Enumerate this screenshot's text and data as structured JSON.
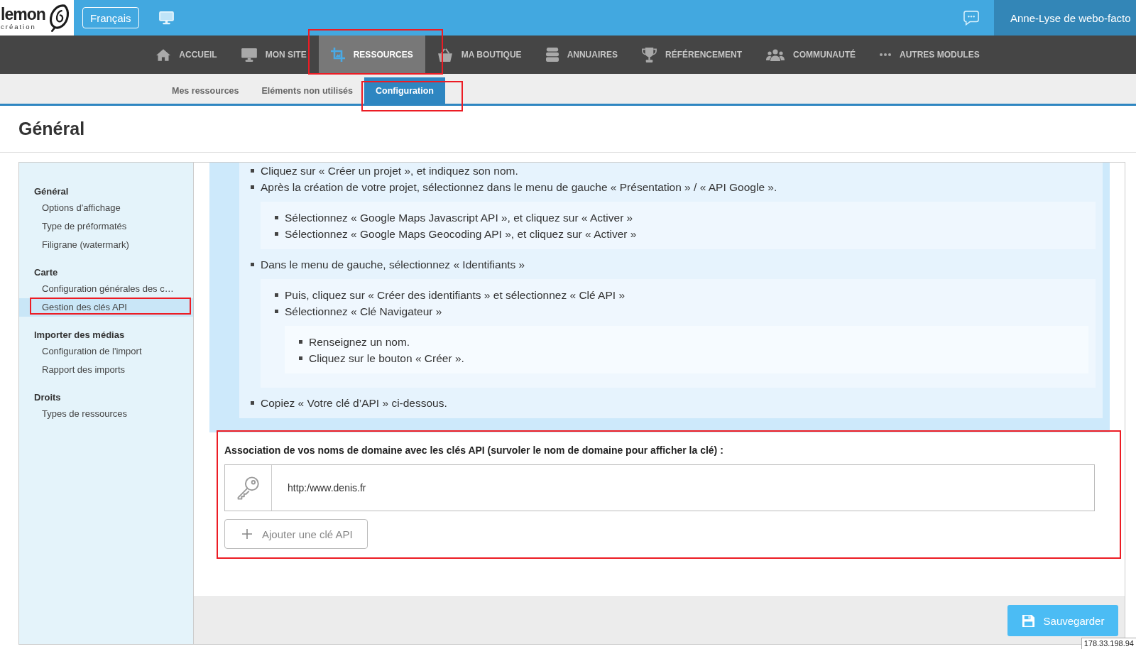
{
  "top_bar": {
    "logo": {
      "name": "lemon",
      "tagline": "création"
    },
    "language_button": "Français",
    "user_name": "Anne-Lyse de webo-facto"
  },
  "main_nav": [
    {
      "label": "ACCUEIL",
      "selected": false,
      "highlighted": false
    },
    {
      "label": "MON SITE",
      "selected": false,
      "highlighted": false
    },
    {
      "label": "RESSOURCES",
      "selected": true,
      "highlighted": true
    },
    {
      "label": "MA BOUTIQUE",
      "selected": false,
      "highlighted": false
    },
    {
      "label": "ANNUAIRES",
      "selected": false,
      "highlighted": false
    },
    {
      "label": "RÉFÉRENCEMENT",
      "selected": false,
      "highlighted": false
    },
    {
      "label": "COMMUNAUTÉ",
      "selected": false,
      "highlighted": false
    },
    {
      "label": "AUTRES MODULES",
      "selected": false,
      "highlighted": false
    }
  ],
  "sub_nav": [
    {
      "label": "Mes ressources",
      "selected": false,
      "highlighted": false
    },
    {
      "label": "Eléments non utilisés",
      "selected": false,
      "highlighted": false
    },
    {
      "label": "Configuration",
      "selected": true,
      "highlighted": true
    }
  ],
  "page_title": "Général",
  "sidebar": {
    "groups": [
      {
        "title": "Général",
        "items": [
          {
            "label": "Options d'affichage",
            "selected": false,
            "highlighted": false
          },
          {
            "label": "Type de préformatés",
            "selected": false,
            "highlighted": false
          },
          {
            "label": "Filigrane (watermark)",
            "selected": false,
            "highlighted": false
          }
        ]
      },
      {
        "title": "Carte",
        "items": [
          {
            "label": "Configuration générales des c…",
            "selected": false,
            "highlighted": false
          },
          {
            "label": "Gestion des clés API",
            "selected": true,
            "highlighted": true
          }
        ]
      },
      {
        "title": "Importer des médias",
        "items": [
          {
            "label": "Configuration de l'import",
            "selected": false,
            "highlighted": false
          },
          {
            "label": "Rapport des imports",
            "selected": false,
            "highlighted": false
          }
        ]
      },
      {
        "title": "Droits",
        "items": [
          {
            "label": "Types de ressources",
            "selected": false,
            "highlighted": false
          }
        ]
      }
    ]
  },
  "instructions": [
    {
      "text": "Cliquez sur « Créer un projet », et indiquez son nom."
    },
    {
      "text": "Après la création de votre projet, sélectionnez dans le menu de gauche « Présentation » / « API Google ».",
      "children": [
        {
          "text": "Sélectionnez « Google Maps Javascript API », et cliquez sur « Activer »"
        },
        {
          "text": "Sélectionnez « Google Maps Geocoding API », et cliquez sur « Activer »"
        }
      ]
    },
    {
      "text": "Dans le menu de gauche, sélectionnez « Identifiants »",
      "children": [
        {
          "text": "Puis, cliquez sur « Créer des identifiants » et sélectionnez « Clé API »"
        },
        {
          "text": "Sélectionnez « Clé Navigateur »",
          "children": [
            {
              "text": "Renseignez un nom."
            },
            {
              "text": "Cliquez sur le bouton « Créer »."
            }
          ]
        }
      ]
    },
    {
      "text": "Copiez « Votre clé d’API » ci-dessous."
    }
  ],
  "domain_keys": {
    "label": "Association de vos noms de domaine avec les clés API (survoler le nom de domaine pour afficher la clé) :",
    "highlighted": true,
    "domains": [
      {
        "name": "http:/www.denis.fr"
      }
    ],
    "add_button": "Ajouter une clé API"
  },
  "footer": {
    "save_button": "Sauvegarder"
  },
  "status_tooltip": "178.33.198.94"
}
